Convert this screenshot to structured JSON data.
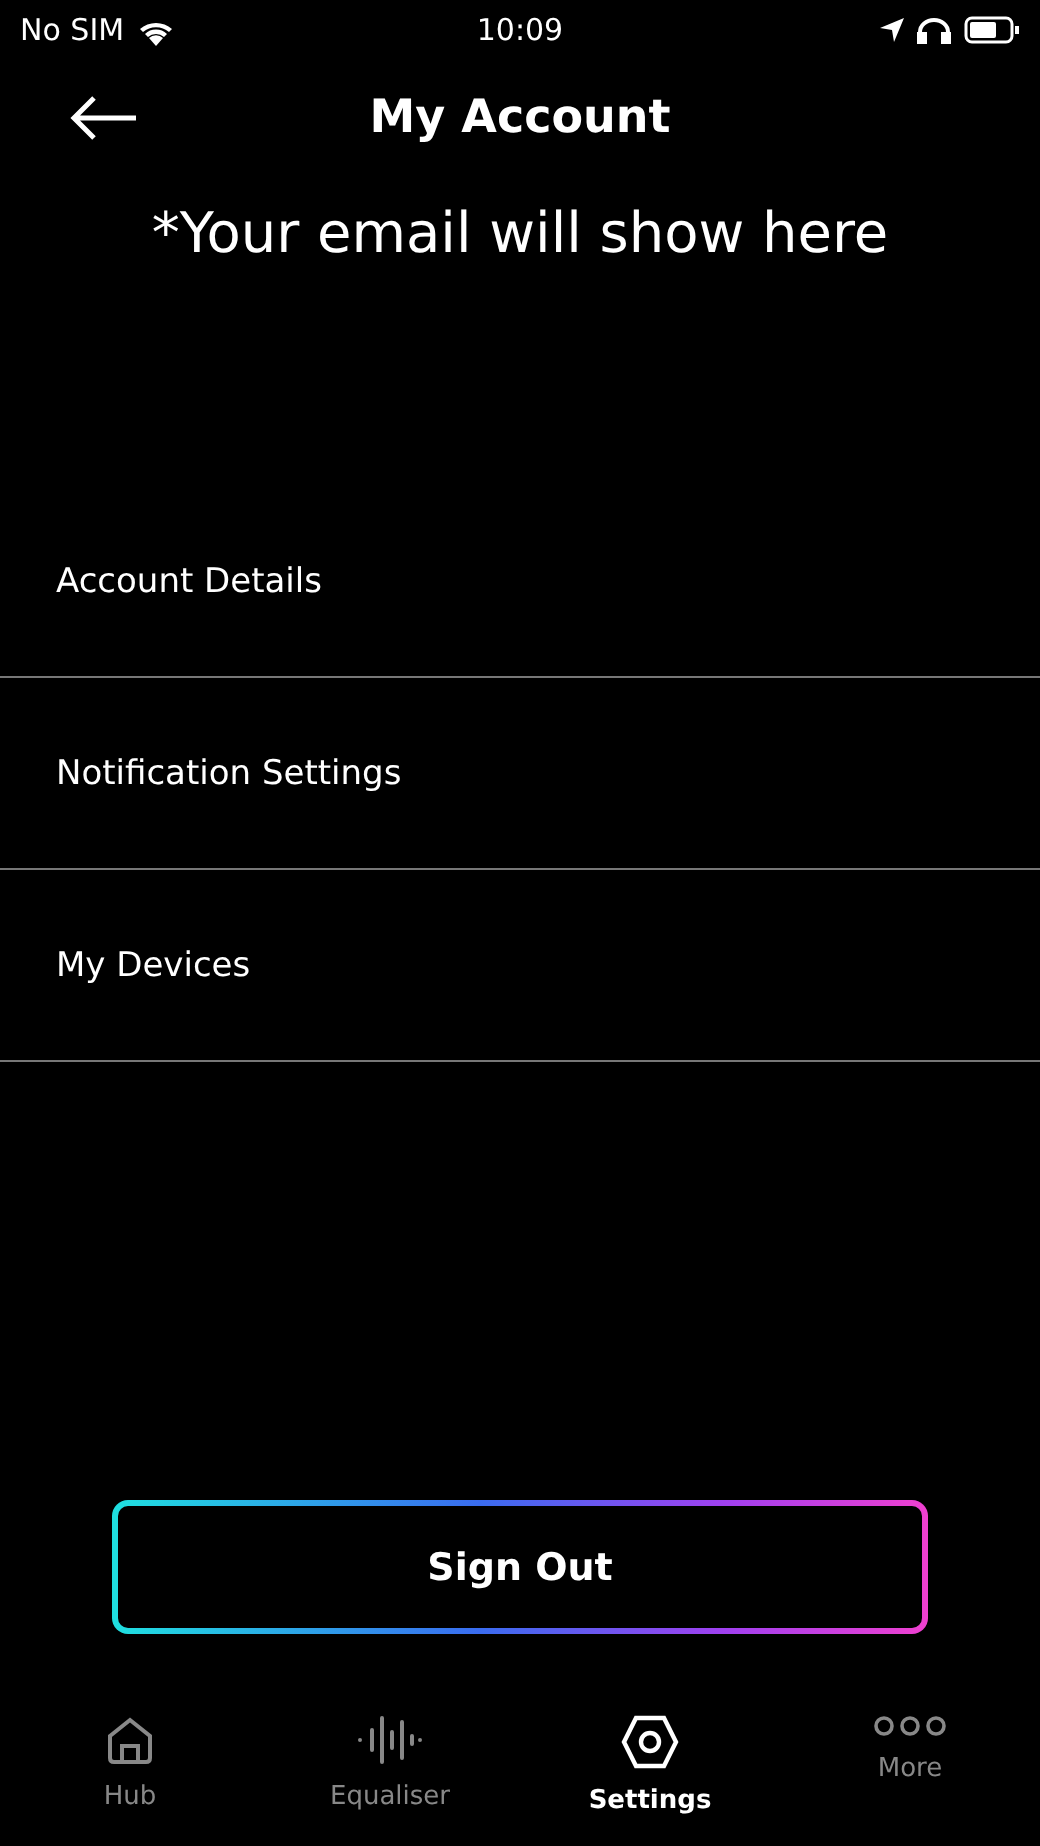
{
  "status_bar": {
    "carrier": "No SIM",
    "time": "10:09"
  },
  "header": {
    "title": "My Account"
  },
  "email_note": "*Your email will show here",
  "menu": [
    {
      "label": "Account Details"
    },
    {
      "label": "Notification Settings"
    },
    {
      "label": "My Devices"
    }
  ],
  "sign_out": "Sign Out",
  "tab_bar": [
    {
      "label": "Hub",
      "selected": false
    },
    {
      "label": "Equaliser",
      "selected": false
    },
    {
      "label": "Settings",
      "selected": true
    },
    {
      "label": "More",
      "selected": false
    }
  ]
}
